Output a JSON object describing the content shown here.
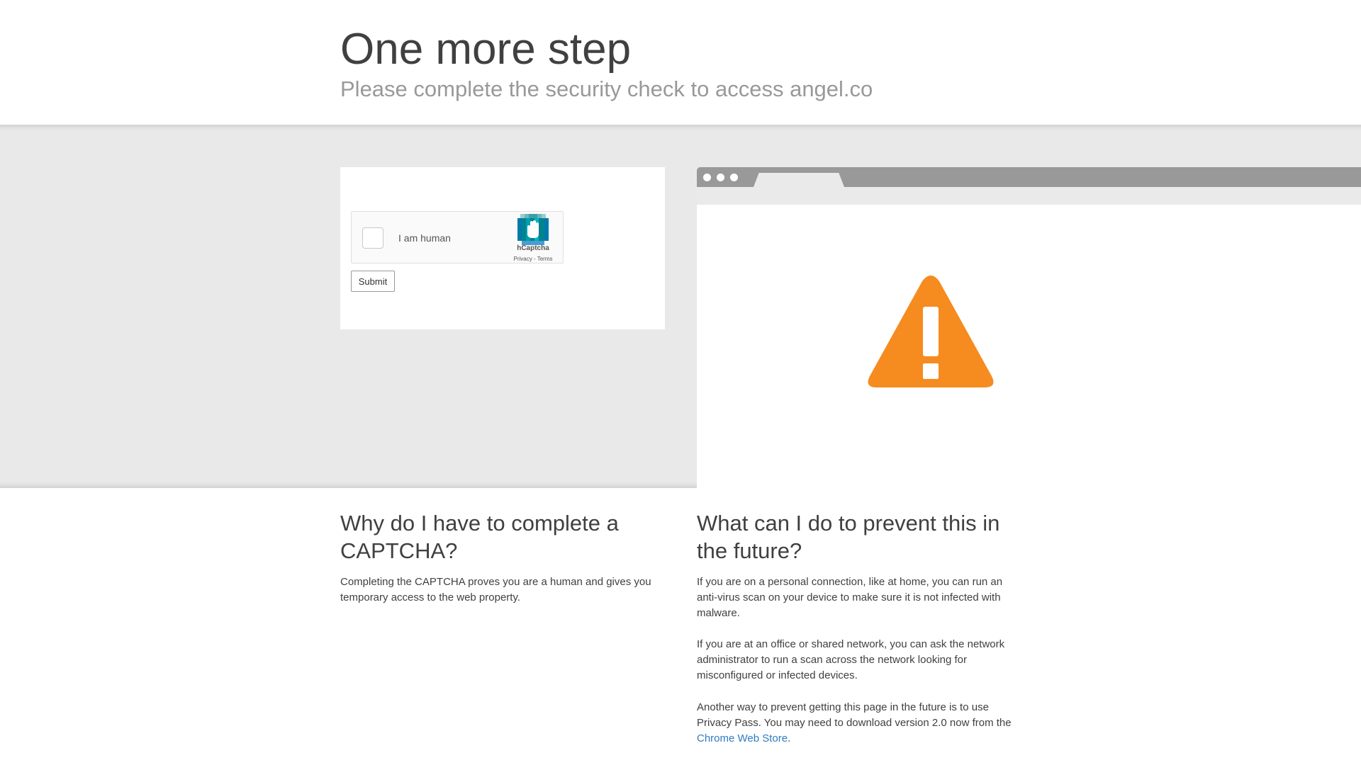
{
  "header": {
    "title": "One more step",
    "subtitle": "Please complete the security check to access angel.co"
  },
  "captcha": {
    "checkbox_label": "I am human",
    "brand": "hCaptcha",
    "privacy_link": "Privacy",
    "separator": " - ",
    "terms_link": "Terms",
    "submit_label": "Submit",
    "checked": false
  },
  "warning": {
    "icon": "warning-triangle-icon",
    "color": "#f68b1f"
  },
  "why": {
    "heading": "Why do I have to complete a CAPTCHA?",
    "paragraph": "Completing the CAPTCHA proves you are a human and gives you temporary access to the web property."
  },
  "prevent": {
    "heading": "What can I do to prevent this in the future?",
    "paragraphs": [
      "If you are on a personal connection, like at home, you can run an anti-virus scan on your device to make sure it is not infected with malware.",
      "If you are at an office or shared network, you can ask the network administrator to run a scan across the network looking for misconfigured or infected devices."
    ],
    "privacy_pass_text": "Another way to prevent getting this page in the future is to use Privacy Pass. You may need to download version 2.0 now from the ",
    "store_link": "Chrome Web Store",
    "store_suffix": "."
  },
  "colors": {
    "accent": "#f68b1f",
    "link": "#2f7bbf",
    "band": "#e9e9e9"
  }
}
